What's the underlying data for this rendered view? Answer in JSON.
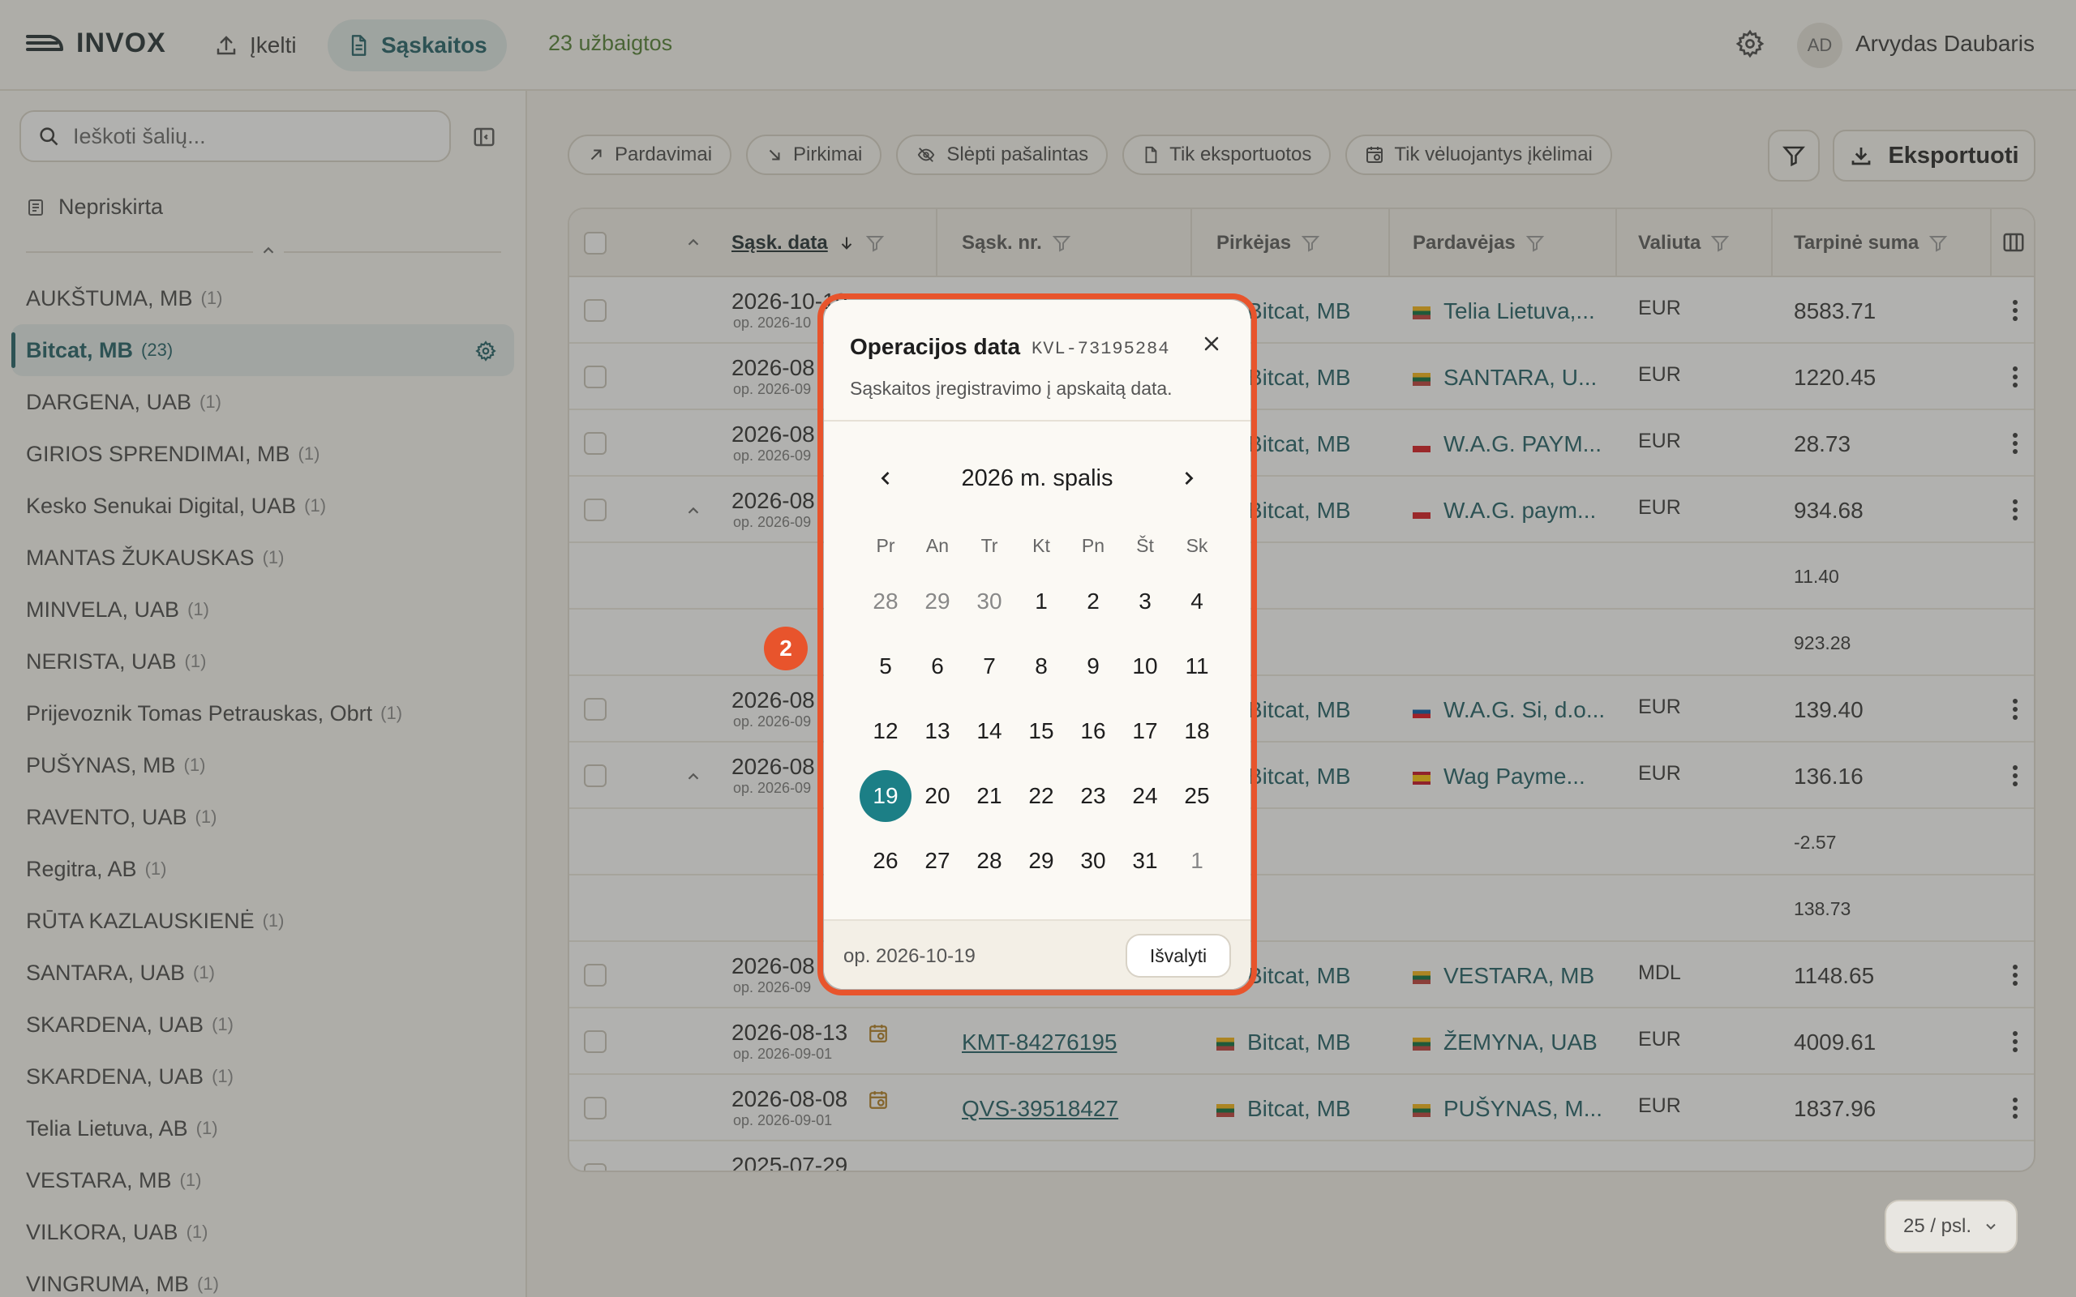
{
  "app": {
    "logo_text": "INVOX"
  },
  "nav": {
    "upload_label": "Įkelti",
    "invoices_label": "Sąskaitos",
    "completed_label": "23 užbaigtos"
  },
  "user": {
    "initials": "AD",
    "name": "Arvydas Daubaris"
  },
  "sidebar": {
    "search_placeholder": "Ieškoti šalių...",
    "unassigned_label": "Nepriskirta",
    "vendors": [
      {
        "name": "AUKŠTUMA, MB",
        "count": "(1)"
      },
      {
        "name": "Bitcat, MB",
        "count": "(23)",
        "active": true
      },
      {
        "name": "DARGENA, UAB",
        "count": "(1)"
      },
      {
        "name": "GIRIOS SPRENDIMAI, MB",
        "count": "(1)"
      },
      {
        "name": "Kesko Senukai Digital, UAB",
        "count": "(1)"
      },
      {
        "name": "MANTAS ŽUKAUSKAS",
        "count": "(1)"
      },
      {
        "name": "MINVELA, UAB",
        "count": "(1)"
      },
      {
        "name": "NERISTA, UAB",
        "count": "(1)"
      },
      {
        "name": "Prijevoznik Tomas Petrauskas, Obrt",
        "count": "(1)"
      },
      {
        "name": "PUŠYNAS, MB",
        "count": "(1)"
      },
      {
        "name": "RAVENTO, UAB",
        "count": "(1)"
      },
      {
        "name": "Regitra, AB",
        "count": "(1)"
      },
      {
        "name": "RŪTA KAZLAUSKIENĖ",
        "count": "(1)"
      },
      {
        "name": "SANTARA, UAB",
        "count": "(1)"
      },
      {
        "name": "SKARDENA, UAB",
        "count": "(1)"
      },
      {
        "name": "SKARDENA, UAB",
        "count": "(1)"
      },
      {
        "name": "Telia Lietuva, AB",
        "count": "(1)"
      },
      {
        "name": "VESTARA, MB",
        "count": "(1)"
      },
      {
        "name": "VILKORA, UAB",
        "count": "(1)"
      },
      {
        "name": "VINGRUMA, MB",
        "count": "(1)"
      }
    ]
  },
  "filters": {
    "sales": "Pardavimai",
    "purchases": "Pirkimai",
    "hide_removed": "Slėpti pašalintas",
    "only_exported": "Tik eksportuotos",
    "only_late": "Tik vėluojantys įkėlimai",
    "export_label": "Eksportuoti"
  },
  "table": {
    "headers": {
      "invoice_date": "Sąsk. data",
      "invoice_no": "Sąsk. nr.",
      "buyer": "Pirkėjas",
      "seller": "Pardavėjas",
      "currency": "Valiuta",
      "subtotal": "Tarpinė suma"
    },
    "rows": [
      {
        "type": "main",
        "date": "2026-10-19",
        "op": "op. 2026-10",
        "inv": "",
        "buyer": "Bitcat, MB",
        "seller": "Telia Lietuva,...",
        "flag": "lt",
        "cur": "EUR",
        "sum": "8583.71"
      },
      {
        "type": "main",
        "date": "2026-08",
        "op": "op. 2026-09",
        "inv": "",
        "buyer": "Bitcat, MB",
        "seller": "SANTARA, U...",
        "flag": "lt",
        "cur": "EUR",
        "sum": "1220.45"
      },
      {
        "type": "main",
        "date": "2026-08",
        "op": "op. 2026-09",
        "inv": "",
        "buyer": "Bitcat, MB",
        "seller": "W.A.G. PAYM...",
        "flag": "cz",
        "cur": "EUR",
        "sum": "28.73"
      },
      {
        "type": "main",
        "expanded": true,
        "date": "2026-08",
        "op": "op. 2026-09",
        "inv": "",
        "buyer": "Bitcat, MB",
        "seller": "W.A.G. paym...",
        "flag": "cz",
        "cur": "EUR",
        "sum": "934.68"
      },
      {
        "type": "sub",
        "sum": "11.40"
      },
      {
        "type": "sub",
        "sum": "923.28"
      },
      {
        "type": "main",
        "date": "2026-08",
        "op": "op. 2026-09",
        "inv": "",
        "buyer": "Bitcat, MB",
        "seller": "W.A.G. Si, d.o...",
        "flag": "si",
        "cur": "EUR",
        "sum": "139.40"
      },
      {
        "type": "main",
        "expanded": true,
        "date": "2026-08",
        "op": "op. 2026-09",
        "inv": "",
        "buyer": "Bitcat, MB",
        "seller": "Wag Payme...",
        "flag": "es",
        "cur": "EUR",
        "sum": "136.16"
      },
      {
        "type": "sub",
        "sum": "-2.57"
      },
      {
        "type": "sub",
        "sum": "138.73"
      },
      {
        "type": "main",
        "date": "2026-08",
        "op": "op. 2026-09",
        "inv": "",
        "buyer": "Bitcat, MB",
        "seller": "VESTARA, MB",
        "flag": "lt",
        "cur": "MDL",
        "sum": "1148.65"
      },
      {
        "type": "main",
        "date": "2026-08-13",
        "op": "op. 2026-09-01",
        "inv": "KMT-84276195",
        "buyer": "Bitcat, MB",
        "seller": "ŽEMYNA, UAB",
        "flag": "lt",
        "cur": "EUR",
        "sum": "4009.61"
      },
      {
        "type": "main",
        "date": "2026-08-08",
        "op": "op. 2026-09-01",
        "inv": "QVS-39518427",
        "buyer": "Bitcat, MB",
        "seller": "PUŠYNAS, M...",
        "flag": "lt",
        "cur": "EUR",
        "sum": "1837.96"
      },
      {
        "type": "main",
        "date": "2025-07-29",
        "op": "",
        "inv": "",
        "buyer": "",
        "seller": "",
        "flag": "",
        "cur": "",
        "sum": ""
      }
    ]
  },
  "pager": {
    "label": "25 / psl."
  },
  "popup": {
    "title": "Operacijos data",
    "code": "KVL-73195284",
    "description": "Sąskaitos įregistravimo į apskaitą data.",
    "month_label": "2026 m. spalis",
    "weekdays": [
      "Pr",
      "An",
      "Tr",
      "Kt",
      "Pn",
      "Št",
      "Sk"
    ],
    "weeks": [
      [
        {
          "d": "28",
          "o": true
        },
        {
          "d": "29",
          "o": true
        },
        {
          "d": "30",
          "o": true
        },
        {
          "d": "1"
        },
        {
          "d": "2"
        },
        {
          "d": "3"
        },
        {
          "d": "4"
        }
      ],
      [
        {
          "d": "5"
        },
        {
          "d": "6"
        },
        {
          "d": "7"
        },
        {
          "d": "8"
        },
        {
          "d": "9"
        },
        {
          "d": "10"
        },
        {
          "d": "11"
        }
      ],
      [
        {
          "d": "12"
        },
        {
          "d": "13"
        },
        {
          "d": "14"
        },
        {
          "d": "15"
        },
        {
          "d": "16"
        },
        {
          "d": "17"
        },
        {
          "d": "18"
        }
      ],
      [
        {
          "d": "19",
          "s": true
        },
        {
          "d": "20"
        },
        {
          "d": "21"
        },
        {
          "d": "22"
        },
        {
          "d": "23"
        },
        {
          "d": "24"
        },
        {
          "d": "25"
        }
      ],
      [
        {
          "d": "26"
        },
        {
          "d": "27"
        },
        {
          "d": "28"
        },
        {
          "d": "29"
        },
        {
          "d": "30"
        },
        {
          "d": "31"
        },
        {
          "d": "1",
          "o": true
        }
      ]
    ],
    "footer_value": "op. 2026-10-19",
    "clear_label": "Išvalyti"
  },
  "step_badge": "2",
  "colors": {
    "accent": "#1c5c62",
    "selected": "#1c7f86",
    "highlight": "#e8542c"
  }
}
